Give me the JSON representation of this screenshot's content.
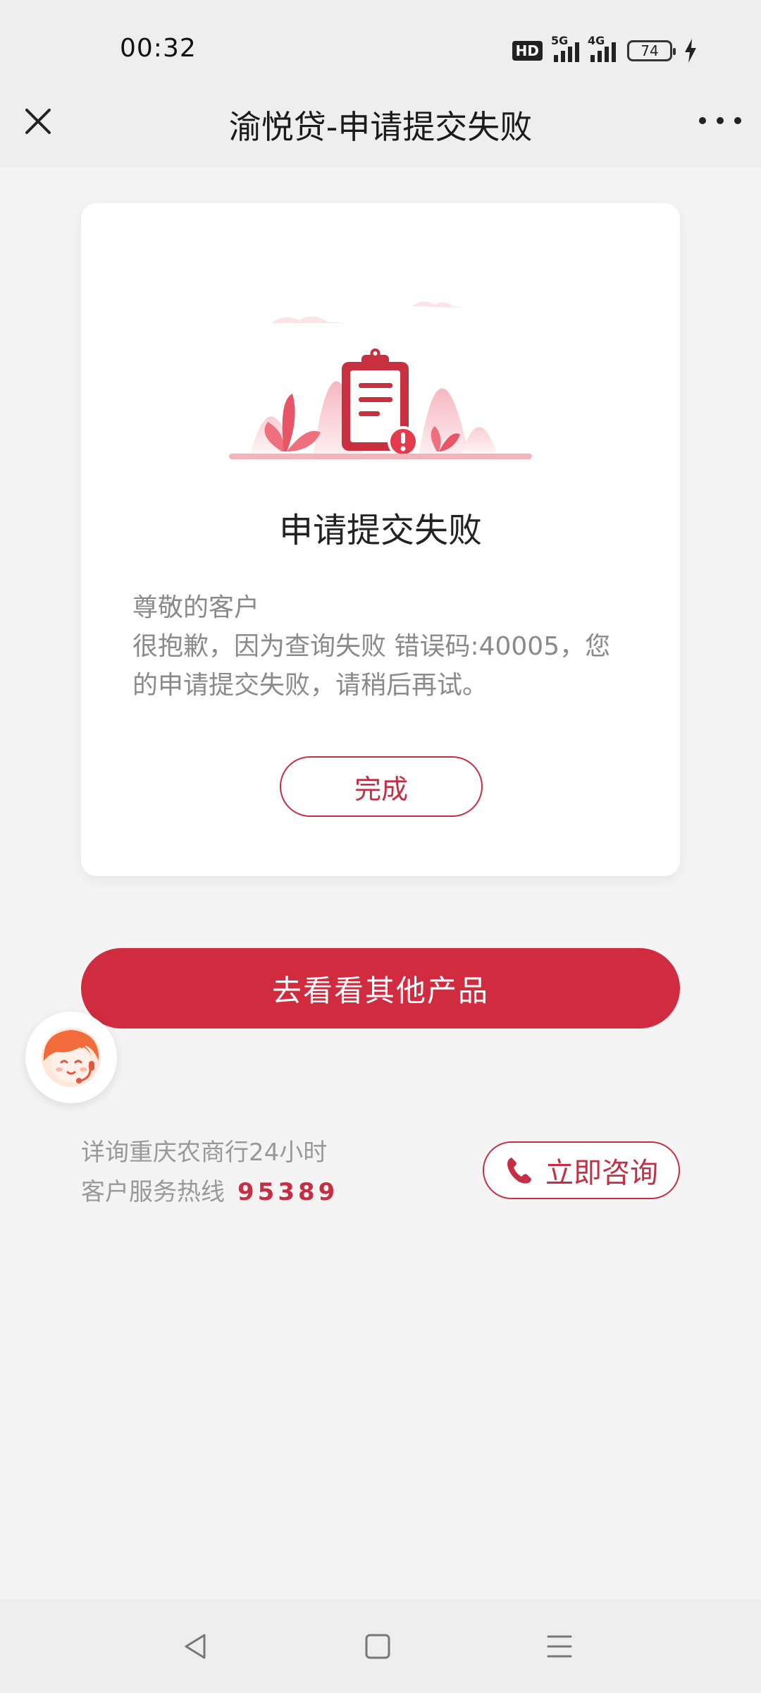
{
  "status_bar": {
    "time": "00:32",
    "hd_label": "HD",
    "signal_1_label": "5G",
    "signal_2_label": "4G",
    "battery": "74"
  },
  "nav": {
    "title": "渝悦贷-申请提交失败",
    "close_icon": "close-icon",
    "more_icon": "more-icon"
  },
  "card": {
    "title": "申请提交失败",
    "greeting": "尊敬的客户",
    "message": "很抱歉，因为查询失败 错误码:40005，您的申请提交失败，请稍后再试。",
    "done_label": "完成"
  },
  "primary_button": "去看看其他产品",
  "hotline": {
    "line1": "详询重庆农商行24小时",
    "line2": "客户服务热线",
    "number": "95389",
    "consult_label": "立即咨询"
  },
  "colors": {
    "accent": "#d02b3e",
    "accent_text": "#c42f44",
    "background": "#f4f4f5"
  }
}
